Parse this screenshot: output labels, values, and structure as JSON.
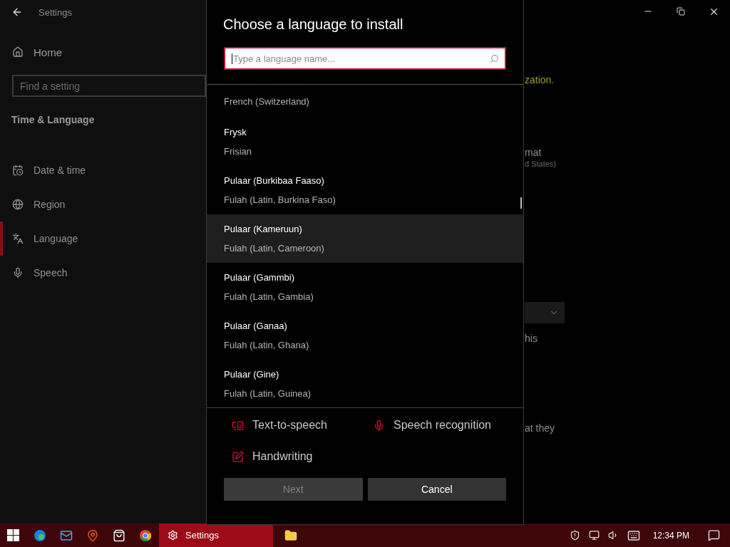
{
  "window": {
    "title": "Settings"
  },
  "sidebar": {
    "home": "Home",
    "search": {
      "placeholder": "Find a setting"
    },
    "section": "Time & Language",
    "items": [
      {
        "label": "Date & time",
        "kind": "calendar",
        "selected": false
      },
      {
        "label": "Region",
        "kind": "globe",
        "selected": false
      },
      {
        "label": "Language",
        "kind": "language",
        "selected": true
      },
      {
        "label": "Speech",
        "kind": "mic",
        "selected": false
      }
    ]
  },
  "background_content": [
    {
      "kind": "link",
      "text": "zation."
    },
    {
      "kind": "text",
      "text": "mat"
    },
    {
      "kind": "subtext",
      "text": "d States)"
    },
    {
      "kind": "dropdown"
    },
    {
      "kind": "text",
      "text": "his"
    },
    {
      "kind": "text",
      "text": "at they"
    }
  ],
  "dialog": {
    "title": "Choose a language to install",
    "search": {
      "placeholder": "Type a language name..."
    },
    "languages": [
      {
        "english": "French (Switzerland)",
        "highlighted": false
      },
      {
        "name": "Frysk",
        "english": "Frisian",
        "highlighted": false
      },
      {
        "name": "Pulaar (Burkibaa Faaso)",
        "english": "Fulah (Latin, Burkina Faso)",
        "highlighted": false
      },
      {
        "name": "Pulaar (Kameruun)",
        "english": "Fulah (Latin, Cameroon)",
        "highlighted": true
      },
      {
        "name": "Pulaar (Gammbi)",
        "english": "Fulah (Latin, Gambia)",
        "highlighted": false
      },
      {
        "name": "Pulaar (Ganaa)",
        "english": "Fulah (Latin, Ghana)",
        "highlighted": false
      },
      {
        "name": "Pulaar (Gine)",
        "english": "Fulah (Latin, Guinea)",
        "highlighted": false
      }
    ],
    "features": [
      {
        "kind": "tts",
        "label": "Text-to-speech"
      },
      {
        "kind": "speech",
        "label": "Speech recognition"
      },
      {
        "kind": "handwriting",
        "label": "Handwriting"
      }
    ],
    "buttons": [
      {
        "label": "Next",
        "disabled": true
      },
      {
        "label": "Cancel",
        "disabled": false
      }
    ]
  },
  "taskbar": {
    "apps": [
      {
        "kind": "start",
        "selected": false
      },
      {
        "kind": "edge",
        "selected": false
      },
      {
        "kind": "mail",
        "selected": false
      },
      {
        "kind": "maps",
        "selected": false
      },
      {
        "kind": "store",
        "selected": false
      },
      {
        "kind": "chrome",
        "selected": false
      },
      {
        "kind": "settings",
        "label": "Settings",
        "selected": true
      },
      {
        "kind": "explorer",
        "selected": false
      }
    ],
    "clock": "12:34 PM"
  }
}
